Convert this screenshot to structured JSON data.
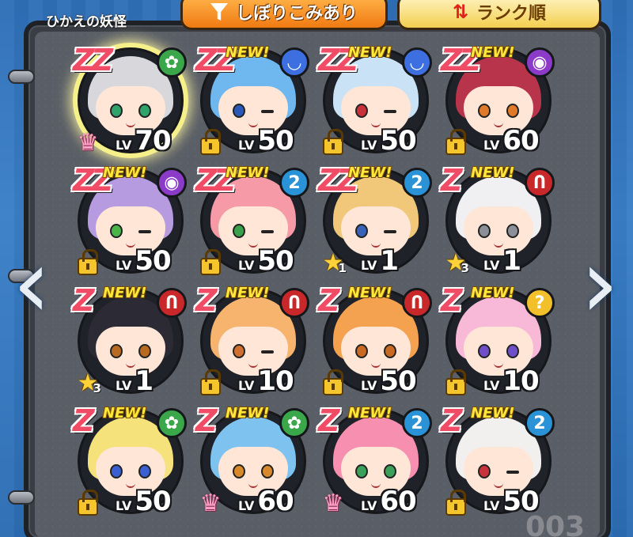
{
  "panel": {
    "title": "ひかえの妖怪"
  },
  "filter_button": {
    "label": "しぼりこみあり",
    "icon": "filter-icon"
  },
  "sort_button": {
    "label": "ランク順",
    "icon": "sort-arrows-icon"
  },
  "navigation": {
    "prev_icon": "chevron-left-icon",
    "next_icon": "chevron-right-icon",
    "prev_glyph": "‹",
    "next_glyph": "›"
  },
  "level_prefix": "LV",
  "new_badge_text": "NEW!",
  "page_number": "003",
  "colors": {
    "rank_z": "#f04c65",
    "new_badge": "#ffe83a",
    "panel": "#3a3d44",
    "background": "#2f6fb7"
  },
  "yokai": [
    {
      "rank": "ZZ",
      "new": false,
      "tribe": "heartful-flower",
      "tribe_glyph": "✿",
      "tribe_color": "#3aa84a",
      "status": "crown",
      "star_count": "",
      "level": "70",
      "hair_color": "#d8d8dc",
      "eye_color": "#2fa36a",
      "wink": false,
      "highlighted": true
    },
    {
      "rank": "ZZ",
      "new": true,
      "tribe": "slippery",
      "tribe_glyph": "◡",
      "tribe_color": "#3d6fe0",
      "status": "lock",
      "star_count": "",
      "level": "50",
      "hair_color": "#6fb8ef",
      "eye_color": "#2a59b8",
      "wink": true,
      "highlighted": false
    },
    {
      "rank": "ZZ",
      "new": true,
      "tribe": "slippery",
      "tribe_glyph": "◡",
      "tribe_color": "#3d6fe0",
      "status": "lock",
      "star_count": "",
      "level": "50",
      "hair_color": "#c9e2f6",
      "eye_color": "#c8333b",
      "wink": true,
      "highlighted": false
    },
    {
      "rank": "ZZ",
      "new": true,
      "tribe": "eerie",
      "tribe_glyph": "◉",
      "tribe_color": "#8c3bc8",
      "status": "lock",
      "star_count": "",
      "level": "60",
      "hair_color": "#b8344a",
      "eye_color": "#e07a2a",
      "wink": false,
      "highlighted": false
    },
    {
      "rank": "ZZ",
      "new": true,
      "tribe": "eerie",
      "tribe_glyph": "◉",
      "tribe_color": "#8c3bc8",
      "status": "lock",
      "star_count": "",
      "level": "50",
      "hair_color": "#b79be0",
      "eye_color": "#49b548",
      "wink": true,
      "highlighted": false
    },
    {
      "rank": "ZZ",
      "new": true,
      "tribe": "mysterious",
      "tribe_glyph": "2",
      "tribe_color": "#2a93d8",
      "status": "lock",
      "star_count": "",
      "level": "50",
      "hair_color": "#f59aa6",
      "eye_color": "#3aa04a",
      "wink": true,
      "highlighted": false
    },
    {
      "rank": "ZZ",
      "new": true,
      "tribe": "mysterious",
      "tribe_glyph": "2",
      "tribe_color": "#2a93d8",
      "status": "star",
      "star_count": "1",
      "level": "1",
      "hair_color": "#f1c879",
      "eye_color": "#3a63b8",
      "wink": true,
      "highlighted": false
    },
    {
      "rank": "Z",
      "new": true,
      "tribe": "shady",
      "tribe_glyph": "Ո",
      "tribe_color": "#c8282a",
      "status": "star",
      "star_count": "3",
      "level": "1",
      "hair_color": "#f0f0f2",
      "eye_color": "#8a8f98",
      "wink": false,
      "highlighted": false
    },
    {
      "rank": "Z",
      "new": true,
      "tribe": "shady",
      "tribe_glyph": "Ո",
      "tribe_color": "#c8282a",
      "status": "star",
      "star_count": "3",
      "level": "1",
      "hair_color": "#2c2a35",
      "eye_color": "#b86a20",
      "wink": false,
      "highlighted": false
    },
    {
      "rank": "Z",
      "new": true,
      "tribe": "shady",
      "tribe_glyph": "Ո",
      "tribe_color": "#c8282a",
      "status": "lock",
      "star_count": "",
      "level": "10",
      "hair_color": "#f6b46e",
      "eye_color": "#d07030",
      "wink": true,
      "highlighted": false
    },
    {
      "rank": "Z",
      "new": true,
      "tribe": "shady",
      "tribe_glyph": "Ո",
      "tribe_color": "#c8282a",
      "status": "lock",
      "star_count": "",
      "level": "50",
      "hair_color": "#f4a150",
      "eye_color": "#c86a22",
      "wink": false,
      "highlighted": false
    },
    {
      "rank": "Z",
      "new": true,
      "tribe": "unknown",
      "tribe_glyph": "?",
      "tribe_color": "#f2c02a",
      "status": "lock",
      "star_count": "",
      "level": "10",
      "hair_color": "#f8b8d8",
      "eye_color": "#6f4fc8",
      "wink": false,
      "highlighted": false
    },
    {
      "rank": "Z",
      "new": true,
      "tribe": "heartful-flower",
      "tribe_glyph": "✿",
      "tribe_color": "#3aa84a",
      "status": "lock",
      "star_count": "",
      "level": "50",
      "hair_color": "#f6e27a",
      "eye_color": "#3a5fd0",
      "wink": false,
      "highlighted": false
    },
    {
      "rank": "Z",
      "new": true,
      "tribe": "heartful-flower",
      "tribe_glyph": "✿",
      "tribe_color": "#3aa84a",
      "status": "crown",
      "star_count": "",
      "level": "60",
      "hair_color": "#7ec3f0",
      "eye_color": "#d88a2a",
      "wink": false,
      "highlighted": false
    },
    {
      "rank": "Z",
      "new": true,
      "tribe": "mysterious",
      "tribe_glyph": "2",
      "tribe_color": "#2a93d8",
      "status": "crown",
      "star_count": "",
      "level": "60",
      "hair_color": "#f78fb0",
      "eye_color": "#3aa05a",
      "wink": false,
      "highlighted": false
    },
    {
      "rank": "Z",
      "new": true,
      "tribe": "mysterious",
      "tribe_glyph": "2",
      "tribe_color": "#2a93d8",
      "status": "lock",
      "star_count": "",
      "level": "50",
      "hair_color": "#f2f0ee",
      "eye_color": "#c8333b",
      "wink": true,
      "highlighted": false
    }
  ]
}
